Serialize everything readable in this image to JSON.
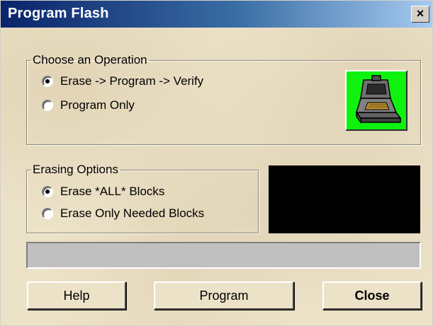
{
  "window": {
    "title": "Program Flash",
    "close_glyph": "×"
  },
  "operation_group": {
    "legend": "Choose an Operation",
    "options": [
      {
        "label": "Erase -> Program -> Verify",
        "checked": true
      },
      {
        "label": "Program Only",
        "checked": false
      }
    ]
  },
  "erasing_group": {
    "legend": "Erasing Options",
    "options": [
      {
        "label": "Erase *ALL* Blocks",
        "checked": true
      },
      {
        "label": "Erase Only Needed Blocks",
        "checked": false
      }
    ]
  },
  "buttons": {
    "help": "Help",
    "program": "Program",
    "close": "Close"
  },
  "icon": {
    "name": "chip-programmer-icon",
    "bg_color": "#00ff00"
  },
  "progress": {
    "value": 0
  }
}
